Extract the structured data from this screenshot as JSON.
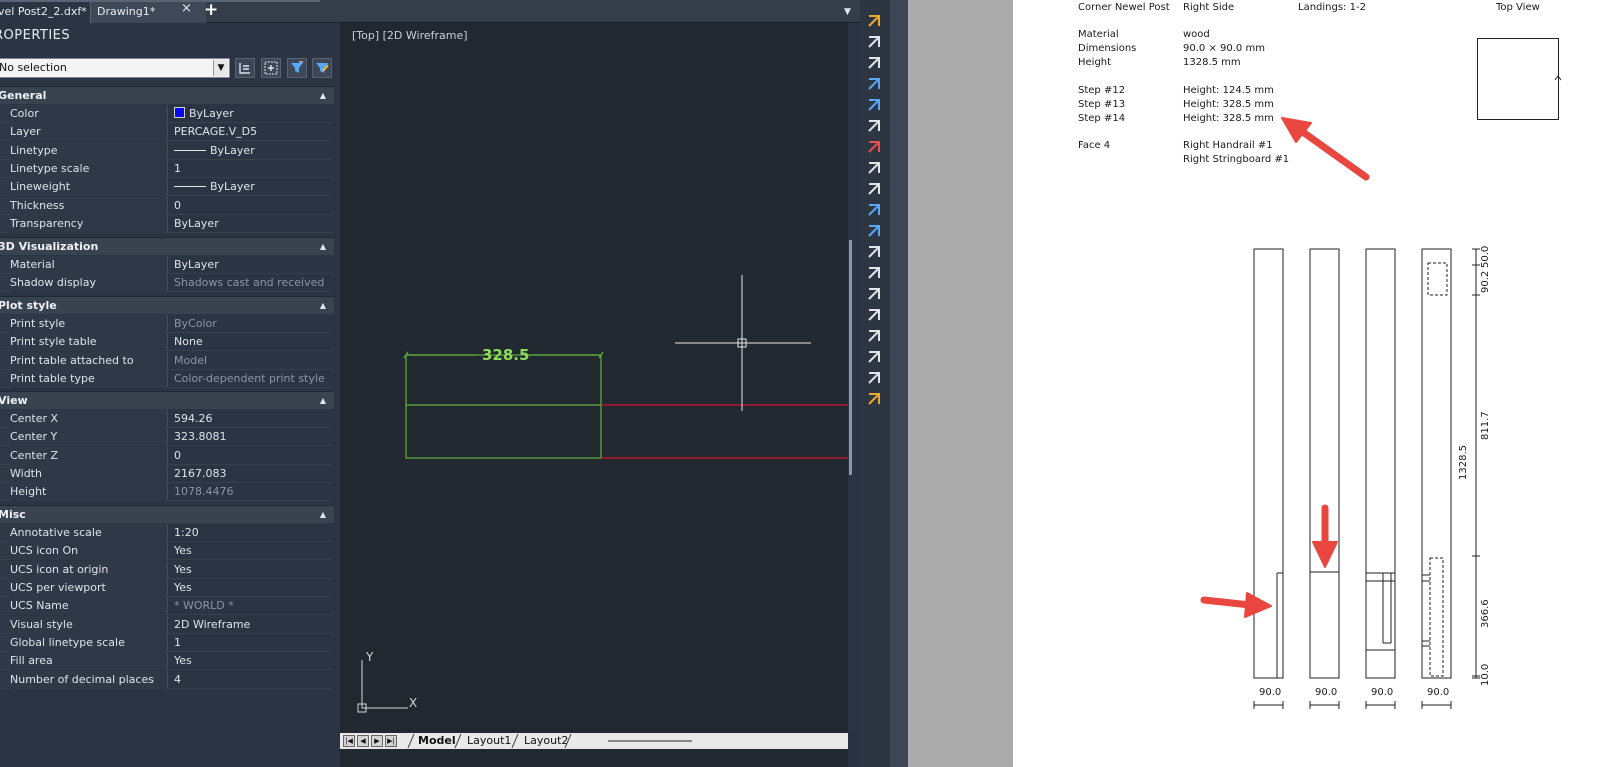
{
  "tabs": [
    {
      "label": "vel Post2_2.dxf*"
    },
    {
      "label": "Drawing1*"
    }
  ],
  "tab_close": "×",
  "tab_add": "+",
  "properties": {
    "title": "ROPERTIES",
    "selection": "No selection",
    "sections": {
      "general": {
        "label": "General",
        "rows": [
          {
            "key": "Color",
            "value": "ByLayer"
          },
          {
            "key": "Layer",
            "value": "PERCAGE.V_D5"
          },
          {
            "key": "Linetype",
            "value": "ByLayer"
          },
          {
            "key": "Linetype scale",
            "value": "1"
          },
          {
            "key": "Lineweight",
            "value": "ByLayer"
          },
          {
            "key": "Thickness",
            "value": "0"
          },
          {
            "key": "Transparency",
            "value": "ByLayer"
          }
        ]
      },
      "viz": {
        "label": "3D Visualization",
        "rows": [
          {
            "key": "Material",
            "value": "ByLayer"
          },
          {
            "key": "Shadow display",
            "value": "Shadows cast and received"
          }
        ]
      },
      "plot": {
        "label": "Plot style",
        "rows": [
          {
            "key": "Print style",
            "value": "ByColor"
          },
          {
            "key": "Print style table",
            "value": "None"
          },
          {
            "key": "Print table attached to",
            "value": "Model"
          },
          {
            "key": "Print table type",
            "value": "Color-dependent print style"
          }
        ]
      },
      "view": {
        "label": "View",
        "rows": [
          {
            "key": "Center X",
            "value": "594.26"
          },
          {
            "key": "Center Y",
            "value": "323.8081"
          },
          {
            "key": "Center Z",
            "value": "0"
          },
          {
            "key": "Width",
            "value": "2167.083"
          },
          {
            "key": "Height",
            "value": "1078.4476"
          }
        ]
      },
      "misc": {
        "label": "Misc",
        "rows": [
          {
            "key": "Annotative scale",
            "value": "1:20"
          },
          {
            "key": "UCS icon On",
            "value": "Yes"
          },
          {
            "key": "UCS icon at origin",
            "value": "Yes"
          },
          {
            "key": "UCS per viewport",
            "value": "Yes"
          },
          {
            "key": "UCS Name",
            "value": "* WORLD *"
          },
          {
            "key": "Visual style",
            "value": "2D Wireframe"
          },
          {
            "key": "Global linetype scale",
            "value": "1"
          },
          {
            "key": "Fill area",
            "value": "Yes"
          },
          {
            "key": "Number of decimal places",
            "value": "4"
          }
        ]
      }
    }
  },
  "viewport": {
    "label": "[Top] [2D Wireframe]",
    "dimension": "328.5",
    "axis_y": "Y",
    "axis_x": "X"
  },
  "layout_tabs": [
    "Model",
    "Layout1",
    "Layout2"
  ],
  "document": {
    "header": {
      "part": "Corner Newel Post",
      "side": "Right Side",
      "landings": "Landings: 1-2",
      "view": "Top View"
    },
    "specs": [
      {
        "key": "Material",
        "value": "wood"
      },
      {
        "key": "Dimensions",
        "value": "90.0 × 90.0 mm"
      },
      {
        "key": "Height",
        "value": "1328.5 mm"
      }
    ],
    "steps": [
      {
        "key": "Step #12",
        "value": "Height: 124.5 mm"
      },
      {
        "key": "Step #13",
        "value": "Height: 328.5 mm"
      },
      {
        "key": "Step #14",
        "value": "Height: 328.5 mm"
      }
    ],
    "face": {
      "key": "Face 4",
      "values": [
        "Right Handrail #1",
        "Right Stringboard #1"
      ]
    },
    "dims": {
      "total": "1328.5",
      "d50": "50.0",
      "d90": "90.2",
      "d811": "811.7",
      "d366": "366.6",
      "d10": "10.0",
      "width": "90.0"
    }
  },
  "colors": {
    "accent_green": "#5fb03a",
    "red_line": "#d2122e",
    "arrow": "#e8463f"
  }
}
